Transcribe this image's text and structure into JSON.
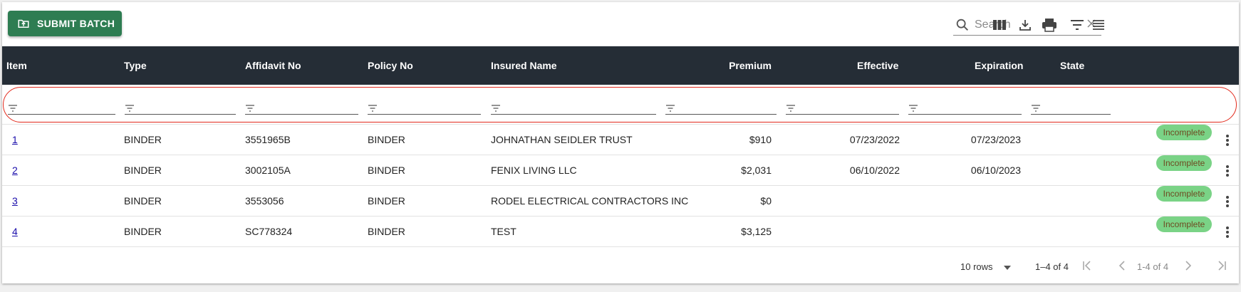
{
  "toolbar": {
    "submit_label": "SUBMIT BATCH",
    "search_placeholder": "Search",
    "icons": [
      "search-icon",
      "clear-icon",
      "columns-icon",
      "download-icon",
      "print-icon",
      "filter-icon",
      "view-list-icon"
    ]
  },
  "columns": [
    "Item",
    "Type",
    "Affidavit No",
    "Policy No",
    "Insured Name",
    "Premium",
    "Effective",
    "Expiration",
    "State"
  ],
  "rows": [
    {
      "item": "1",
      "type": "BINDER",
      "affidavit": "3551965B",
      "policy": "BINDER",
      "insured": "JOHNATHAN SEIDLER TRUST",
      "premium": "$910",
      "effective": "07/23/2022",
      "expiration": "07/23/2023",
      "state": "Incomplete"
    },
    {
      "item": "2",
      "type": "BINDER",
      "affidavit": "3002105A",
      "policy": "BINDER",
      "insured": "FENIX LIVING LLC",
      "premium": "$2,031",
      "effective": "06/10/2022",
      "expiration": "06/10/2023",
      "state": "Incomplete"
    },
    {
      "item": "3",
      "type": "BINDER",
      "affidavit": "3553056",
      "policy": "BINDER",
      "insured": "RODEL ELECTRICAL CONTRACTORS INC",
      "premium": "$0",
      "effective": "",
      "expiration": "",
      "state": "Incomplete"
    },
    {
      "item": "4",
      "type": "BINDER",
      "affidavit": "SC778324",
      "policy": "BINDER",
      "insured": "TEST",
      "premium": "$3,125",
      "effective": "",
      "expiration": "",
      "state": "Incomplete"
    }
  ],
  "pagination": {
    "rows_per_page": "10 rows",
    "range": "1–4 of 4",
    "page_label": "1-4 of 4"
  },
  "colors": {
    "header_bg": "#252d36",
    "button_green": "#2e7d52",
    "badge_bg": "#7ad386",
    "badge_text": "#6e4a21",
    "filter_outline": "#e22a1c"
  }
}
